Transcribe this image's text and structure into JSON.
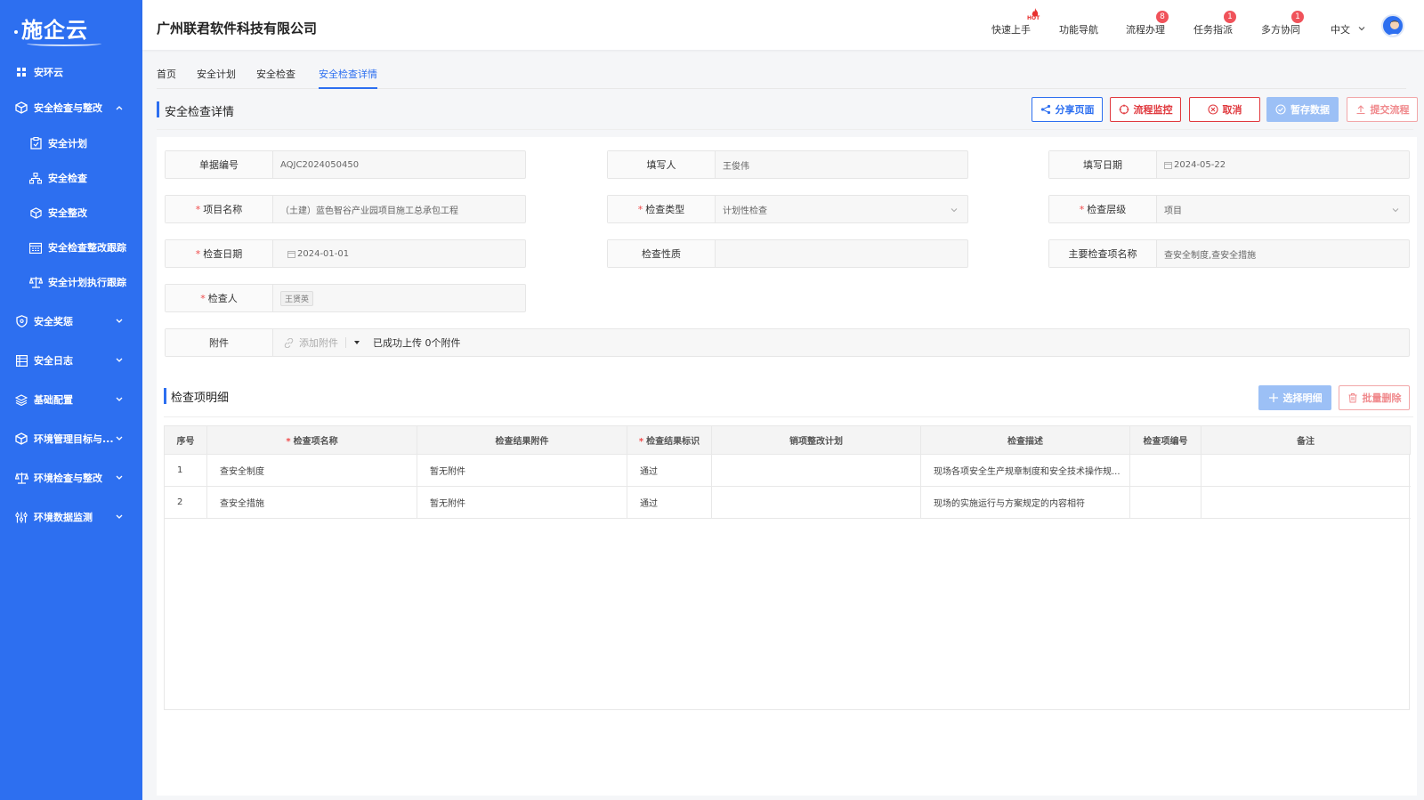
{
  "app": {
    "logo_text": "施企云"
  },
  "sidebar": {
    "items": [
      {
        "label": "安环云",
        "icon": "grid-icon"
      },
      {
        "label": "安全检查与整改",
        "icon": "cube-icon"
      },
      {
        "label": "安全计划",
        "icon": "clipboard-icon"
      },
      {
        "label": "安全检查",
        "icon": "org-icon"
      },
      {
        "label": "安全整改",
        "icon": "cube-icon"
      },
      {
        "label": "安全检查整改跟踪",
        "icon": "calendar-icon"
      },
      {
        "label": "安全计划执行跟踪",
        "icon": "scale-icon"
      },
      {
        "label": "安全奖惩",
        "icon": "shield-icon"
      },
      {
        "label": "安全日志",
        "icon": "table-icon"
      },
      {
        "label": "基础配置",
        "icon": "layers-icon"
      },
      {
        "label": "环境管理目标与...",
        "icon": "cube-icon"
      },
      {
        "label": "环境检查与整改",
        "icon": "scale-icon"
      },
      {
        "label": "环境数据监测",
        "icon": "sliders-icon"
      }
    ]
  },
  "topbar": {
    "company": "广州联君软件科技有限公司",
    "links": [
      {
        "label": "快速上手",
        "badge": ""
      },
      {
        "label": "功能导航",
        "badge": ""
      },
      {
        "label": "流程办理",
        "badge": "8"
      },
      {
        "label": "任务指派",
        "badge": "1"
      },
      {
        "label": "多方协同",
        "badge": "1"
      }
    ],
    "hot_label": "HOT",
    "language": "中文"
  },
  "tabs": [
    "首页",
    "安全计划",
    "安全检查",
    "安全检查详情"
  ],
  "page": {
    "title": "安全检查详情",
    "buttons": {
      "share": "分享页面",
      "monitor": "流程监控",
      "cancel": "取消",
      "save": "暂存数据",
      "submit": "提交流程"
    }
  },
  "form": {
    "doc_no": {
      "label": "单据编号",
      "value": "AQJC2024050450"
    },
    "writer": {
      "label": "填写人",
      "value": "王俊伟"
    },
    "write_date": {
      "label": "填写日期",
      "value": "2024-05-22"
    },
    "project": {
      "label": "项目名称",
      "value": "（土建）蓝色智谷产业园项目施工总承包工程"
    },
    "check_type": {
      "label": "检查类型",
      "value": "计划性检查"
    },
    "check_level": {
      "label": "检查层级",
      "value": "项目"
    },
    "check_date": {
      "label": "检查日期",
      "value": "2024-01-01"
    },
    "check_nature": {
      "label": "检查性质",
      "value": ""
    },
    "main_items": {
      "label": "主要检查项名称",
      "value": "查安全制度,查安全措施"
    },
    "inspector": {
      "label": "检查人",
      "value": "王贤英"
    },
    "attachment": {
      "label": "附件",
      "add_label": "添加附件",
      "status": "已成功上传 0个附件"
    }
  },
  "details": {
    "title": "检查项明细",
    "select_button": "选择明细",
    "delete_button": "批量删除",
    "columns": [
      "序号",
      "检查项名称",
      "检查结果附件",
      "检查结果标识",
      "销项整改计划",
      "检查描述",
      "检查项编号",
      "备注"
    ],
    "rows": [
      [
        "1",
        "查安全制度",
        "暂无附件",
        "通过",
        "",
        "现场各项安全生产规章制度和安全技术操作规...",
        "",
        ""
      ],
      [
        "2",
        "查安全措施",
        "暂无附件",
        "通过",
        "",
        "现场的实施运行与方案规定的内容相符",
        "",
        ""
      ]
    ]
  }
}
